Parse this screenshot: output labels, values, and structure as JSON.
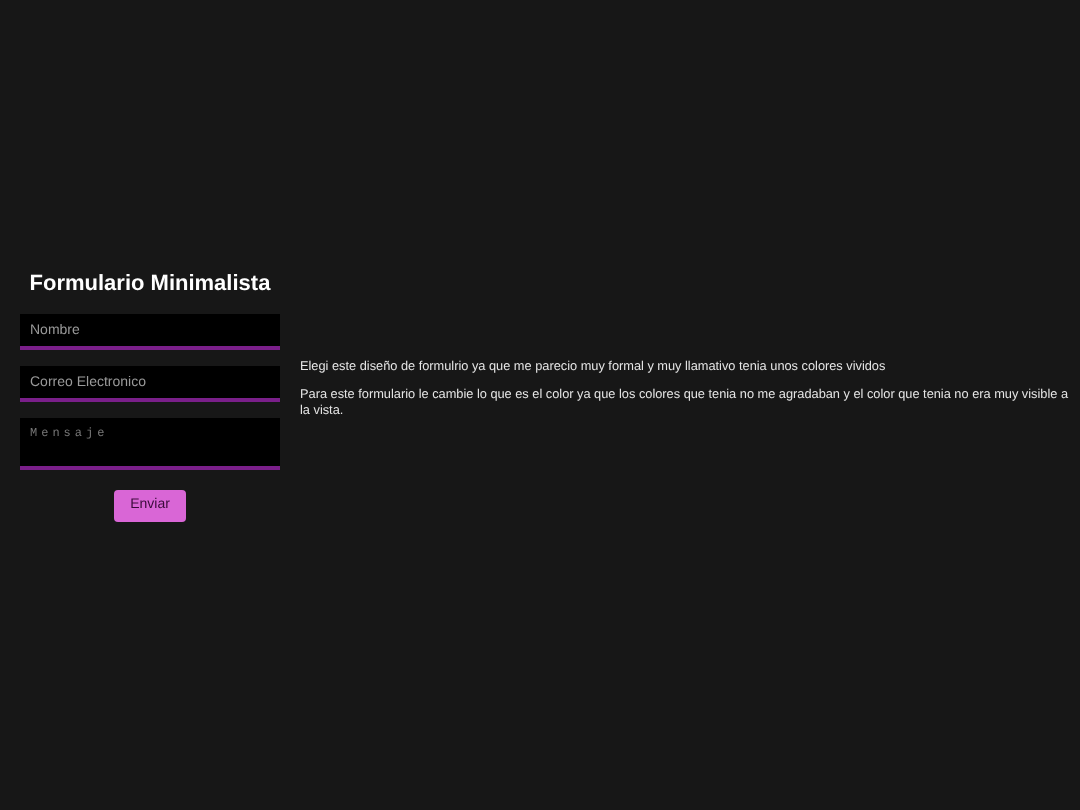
{
  "form": {
    "title": "Formulario Minimalista",
    "fields": [
      {
        "kind": "input",
        "placeholder": "Nombre"
      },
      {
        "kind": "input",
        "placeholder": "Correo Electronico"
      },
      {
        "kind": "textarea",
        "placeholder": "Mensaje"
      }
    ],
    "submit": "Enviar"
  },
  "paragraphs": [
    "Elegi este diseño de formulrio ya que me parecio muy formal y muy llamativo tenia unos colores vividos",
    "Para este formulario le cambie lo que es el color ya que los colores que tenia no me agradaban y el color que tenia no era muy visible a la vista."
  ]
}
